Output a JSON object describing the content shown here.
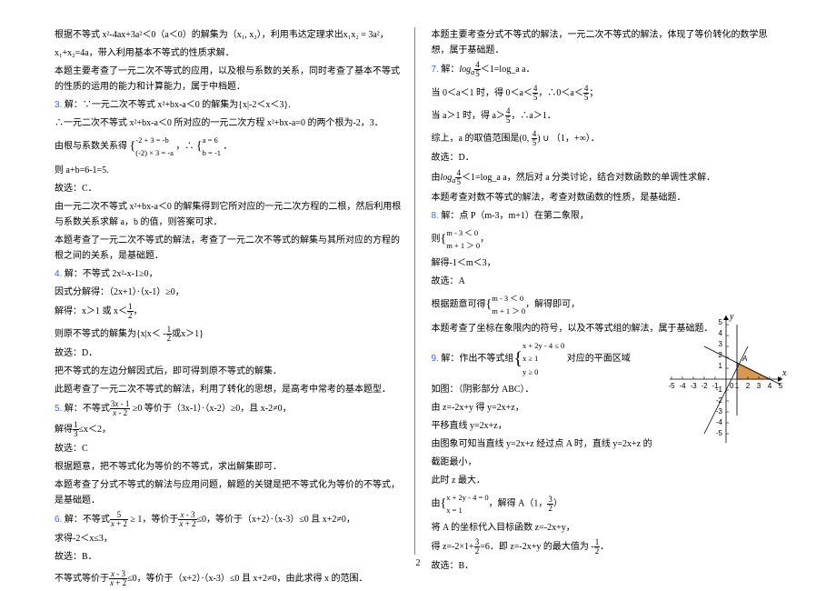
{
  "page_number": "2",
  "left": {
    "p1": "根据不等式 x²-4ax+3a²＜0（a＜0）的解集为（x₁, x₂），利用韦达定理求出x₁x₂ = 3a²，",
    "p2": "x₁+x₂=4a，带入利用基本不等式的性质求解．",
    "p3": "本题主要考查了一元二次不等式的应用，以及根与系数的关系，同时考查了基本不等式的性质的运用的能力和计算能力，属于中档题．",
    "n3": "3.",
    "p4": "解：∵一元二次不等式 x²+bx-a＜0 的解集为{x|-2＜x＜3}.",
    "p5": "∴一元二次不等式 x²+bx-a＜0 所对应的一元二次方程 x²+bx-a=0 的两个根为-2，3．",
    "p6a": "由根与系数关系得",
    "p6b": "-2 + 3 = -b",
    "p6c": "(-2) × 3 = -a",
    "p6d": "，∴",
    "p6e": "a = 6",
    "p6f": "b = -1",
    "p6g": "．",
    "p7": "则 a+b=6-1=5.",
    "p8": "故选：C．",
    "p9": "由一元二次不等式 x²+bx-a＜0 的解集得到它所对应的一元二次方程的二根，然后利用根与系数关系求解 a，b 的值，则答案可求．",
    "p10": "本题考查了一元二次不等式的解法，考查了一元二次不等式的解集与其所对应的方程的根之间的关系，是基础题．",
    "n4": "4.",
    "p11": "解：不等式 2x²-x-1≥0，",
    "p12": "因式分解得：（2x+1）·（x-1）≥0，",
    "p13a": "解得：x＞1 或 x＜",
    "p13b": "，",
    "p14a": "则原不等式的解集为{x|x＜ -",
    "p14b": "或x＞1}",
    "p15": "故选：D．",
    "p16": "把不等式的左边分解因式后，即可得到原不等式的解集．",
    "p17": "此题考查了一元二次不等式的解法，利用了转化的思想，是高考中常考的基本题型．",
    "n5": "5.",
    "p18a": "解：不等式",
    "p18b": " ≥0 等价于（3x-1）·（x-2）≥0，且 x-2≠0，",
    "p19a": "解得",
    "p19b": "≤x＜2，",
    "p20": "故选：C",
    "p21": "根据题意，把不等式化为等价的不等式，求出解集即可．",
    "p22": "本题考查了分式不等式的解法与应用问题，解题的关键是把不等式化为等价的不等式，是基础题．",
    "n6": "6.",
    "p23a": "解：不等式",
    "p23b": " ≥ 1，等价于",
    "p23c": "≤0，等价于（x+2）·（x-3）≤0 且 x+2≠0，",
    "p24": "求得-2＜x≤3，",
    "p25": "故选：B．",
    "p26a": "不等式等价于",
    "p26b": "≤0，等价于（x+2）·（x-3）≤0 且 x+2≠0，由此求得 x 的范围．"
  },
  "right": {
    "p1": "本题主要考查分式不等式的解法，一元二次不等式的解法，体现了等价转化的数学思想，属于基础题．",
    "n7": "7.",
    "p2a": "解：",
    "p2b": "＜1=log_a a．",
    "p3a": "当 0＜a＜1 时，得 0＜a＜",
    "p3b": "，∴0＜a＜",
    "p3c": "；",
    "p4a": "当 a＞1 时，得 a＞",
    "p4b": "，∴a＞1．",
    "p5a": "综上，a 的取值范围是(0, ",
    "p5b": ") ∪ （1，+∞）．",
    "p6": "故选：D．",
    "p7a": "由",
    "p7b": "＜1=log_a a，然后对 a 分类讨论，结合对数函数的单调性求解．",
    "p8": "本题考查对数不等式的解法，考查对数函数的性质，是基础题．",
    "n8": "8.",
    "p9": "解：点 P（m-3，m+1）在第二象限，",
    "p10a": "则",
    "p10b": "m - 3 ＜ 0",
    "p10c": "m + 1 ＞ 0",
    "p10d": "，",
    "p11": "解得-1＜m＜3，",
    "p12": "故选：A",
    "p13a": "根据题意可得",
    "p13b": "m - 3 ＜ 0",
    "p13c": "m + 1 ＞ 0",
    "p13d": "，解得即可，",
    "p14": "本题考查了坐标在象限内的符号，以及不等式组的解法，属于基础题．",
    "n9": "9.",
    "p15a": "解：作出不等式组",
    "p15b": "x + 2y - 4 ≤ 0",
    "p15c": "x ≥ 1",
    "p15d": "y ≥ 0",
    "p15e": " 对应的平面区域",
    "p16": "如图：（阴影部分 ABC）．",
    "p17": "由 z=-2x+y 得 y=2x+z，",
    "p18": "平移直线 y=2x+z，",
    "p19": "由图象可知当直线 y=2x+z 经过点 A 时，直线 y=2x+z 的",
    "p20": "截距最小，",
    "p21": "此时 z 最大．",
    "p22a": "由",
    "p22b": "x + 2y - 4 = 0",
    "p22c": "x = 1",
    "p22d": "，解得 A（1，",
    "p22e": "）",
    "p23": "将 A 的坐标代入目标函数 z=-2x+y，",
    "p24a": "得 z=-2×1+",
    "p24b": "=6．即 z=-2x+y 的最大值为 -",
    "p24c": "．",
    "p25": "故选：B．"
  },
  "chart_data": {
    "type": "line",
    "title": "",
    "xlabel": "x",
    "ylabel": "y",
    "xlim": [
      -5,
      5
    ],
    "ylim": [
      -5,
      5
    ],
    "x_ticks": [
      -5,
      -4,
      -3,
      -2,
      -1,
      0,
      1,
      2,
      3,
      4,
      5
    ],
    "y_ticks": [
      -5,
      -4,
      -3,
      -2,
      -1,
      1,
      2,
      3,
      4,
      5
    ],
    "feasible_region_vertices": [
      {
        "x": 1,
        "y": 0,
        "label": ""
      },
      {
        "x": 4,
        "y": 0,
        "label": ""
      },
      {
        "x": 1,
        "y": 1.5,
        "label": "A"
      }
    ],
    "constraints": [
      {
        "name": "x + 2y - 4 = 0",
        "points": [
          [
            -2,
            3
          ],
          [
            4,
            0
          ]
        ]
      },
      {
        "name": "x = 1",
        "points": [
          [
            1,
            -3
          ],
          [
            1,
            5
          ]
        ]
      },
      {
        "name": "y = 0",
        "is_axis": true
      }
    ],
    "objective_line": {
      "name": "y = 2x + z",
      "slope": 2,
      "sample_points": [
        [
          -2,
          -5
        ],
        [
          2,
          3
        ]
      ]
    }
  }
}
